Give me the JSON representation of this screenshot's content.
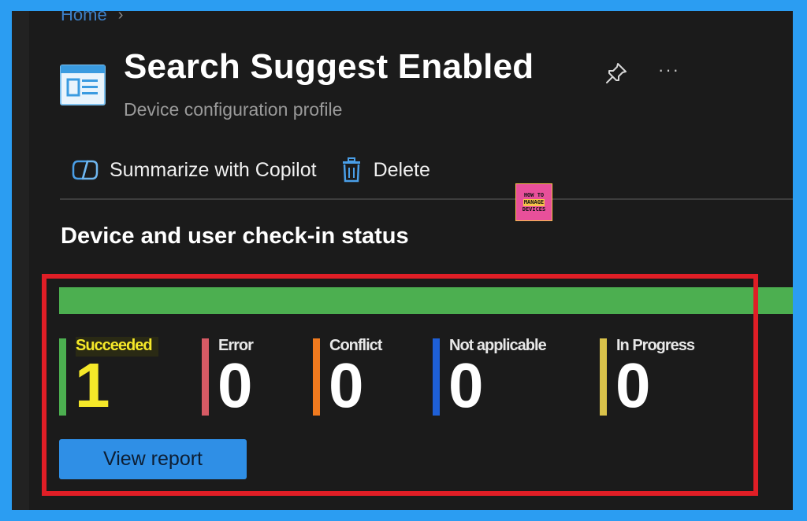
{
  "breadcrumb": {
    "home": "Home",
    "separator": "›"
  },
  "header": {
    "icon": "profile-document-icon",
    "title": "Search Suggest Enabled",
    "subtitle": "Device configuration profile",
    "pin_icon": "pin-icon",
    "more_label": "···"
  },
  "toolbar": {
    "copilot_label": "Summarize with Copilot",
    "copilot_icon": "copilot-icon",
    "delete_label": "Delete",
    "delete_icon": "trash-icon"
  },
  "watermark": {
    "line1": "HOW TO",
    "line2": "MANAGE",
    "line3": "DEVICES"
  },
  "checkin": {
    "title": "Device and user check-in status",
    "bar_color": "#4caf50",
    "statuses": [
      {
        "label": "Succeeded",
        "count": "1",
        "color": "#4caf50"
      },
      {
        "label": "Error",
        "count": "0",
        "color": "#d65a64"
      },
      {
        "label": "Conflict",
        "count": "0",
        "color": "#f07a1e"
      },
      {
        "label": "Not applicable",
        "count": "0",
        "color": "#1e5fd6"
      },
      {
        "label": "In Progress",
        "count": "0",
        "color": "#d9c24a"
      }
    ],
    "view_report_label": "View report"
  },
  "colors": {
    "accent": "#2f8fe6",
    "highlight": "#e01e26",
    "background": "#1b1b1b",
    "outer": "#2b9df2"
  }
}
